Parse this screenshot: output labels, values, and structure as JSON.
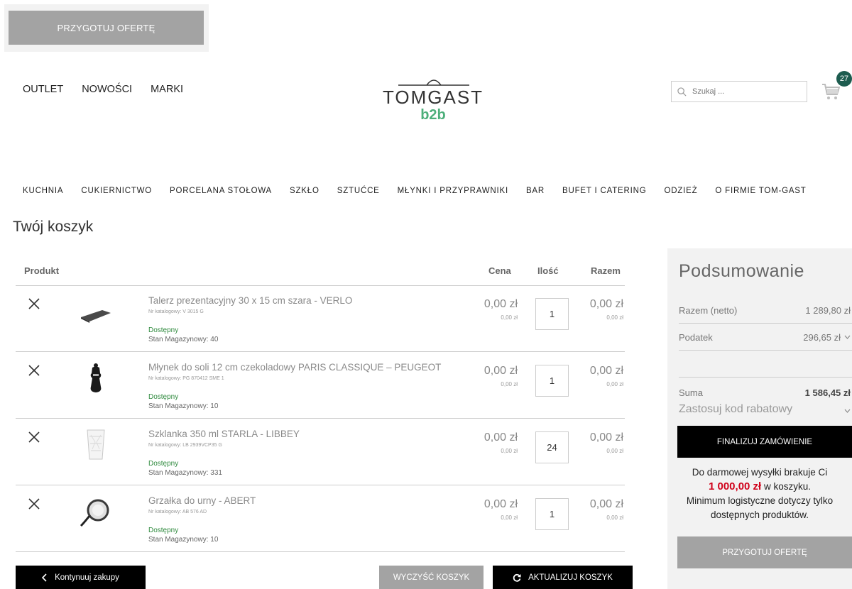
{
  "top_bar": {
    "offer_label": "PRZYGOTUJ OFERTĘ"
  },
  "header": {
    "nav": [
      "OUTLET",
      "NOWOŚCI",
      "MARKI"
    ],
    "logo_main": "TOMGAST",
    "logo_sub": "b2b",
    "search_placeholder": "Szukaj ...",
    "cart_count": "27"
  },
  "categories": [
    "KUCHNIA",
    "CUKIERNICTWO",
    "PORCELANA STOŁOWA",
    "SZKŁO",
    "SZTUĆCE",
    "MŁYNKI I PRZYPRAWNIKI",
    "BAR",
    "BUFET I CATERING",
    "ODZIEŻ",
    "O FIRMIE TOM-GAST"
  ],
  "page_title": "Twój koszyk",
  "table_headers": {
    "product": "Produkt",
    "price": "Cena",
    "qty": "Ilość",
    "total": "Razem"
  },
  "items": [
    {
      "name": "Talerz prezentacyjny 30 x 15 cm szara - VERLO",
      "sku": "Nr katalogowy: V 3015 G",
      "availability": "Dostępny",
      "stock": "Stan Magazynowy: 40",
      "price": "0,00 zł",
      "price_sub": "0,00 zł",
      "qty": "1",
      "total": "0,00 zł",
      "total_sub": "0,00 zł",
      "thumb": "slate-plate"
    },
    {
      "name": "Młynek do soli 12 cm czekoladowy PARIS CLASSIQUE – PEUGEOT",
      "sku": "Nr katalogowy: PG 870412 SME 1",
      "availability": "Dostępny",
      "stock": "Stan Magazynowy: 10",
      "price": "0,00 zł",
      "price_sub": "0,00 zł",
      "qty": "1",
      "total": "0,00 zł",
      "total_sub": "0,00 zł",
      "thumb": "salt-mill"
    },
    {
      "name": "Szklanka 350 ml STARLA - LIBBEY",
      "sku": "Nr katalogowy: LB 2939VCP35 G",
      "availability": "Dostępny",
      "stock": "Stan Magazynowy: 331",
      "price": "0,00 zł",
      "price_sub": "0,00 zł",
      "qty": "24",
      "total": "0,00 zł",
      "total_sub": "0,00 zł",
      "thumb": "glass"
    },
    {
      "name": "Grzałka do urny - ABERT",
      "sku": "Nr katalogowy: AB 576 AD",
      "availability": "Dostępny",
      "stock": "Stan Magazynowy: 10",
      "price": "0,00 zł",
      "price_sub": "0,00 zł",
      "qty": "1",
      "total": "0,00 zł",
      "total_sub": "0,00 zł",
      "thumb": "heater"
    }
  ],
  "buttons": {
    "continue": "Kontynuuj zakupy",
    "clear": "WYCZYŚĆ KOSZYK",
    "update": "AKTUALIZUJ KOSZYK"
  },
  "summary": {
    "title": "Podsumowanie",
    "net_label": "Razem (netto)",
    "net_value": "1 289,80 zł",
    "tax_label": "Podatek",
    "tax_value": "296,65 zł",
    "sum_label": "Suma",
    "sum_value": "1 586,45 zł",
    "promo_label": "Zastosuj kod rabatowy",
    "finalize": "FINALIZUJ ZAMÓWIENIE",
    "free_ship_1": "Do darmowej wysyłki brakuje Ci",
    "free_ship_amount": "1 000,00 zł",
    "free_ship_2": "w koszyku.",
    "free_ship_3": "Minimum logistyczne dotyczy tylko",
    "free_ship_4": "dostępnych produktów.",
    "offer": "PRZYGOTUJ OFERTĘ"
  },
  "colors": {
    "brand_green": "#4caf7a",
    "badge": "#1d5c4f",
    "available": "#2f8a3e",
    "highlight_red": "#d0021b"
  }
}
